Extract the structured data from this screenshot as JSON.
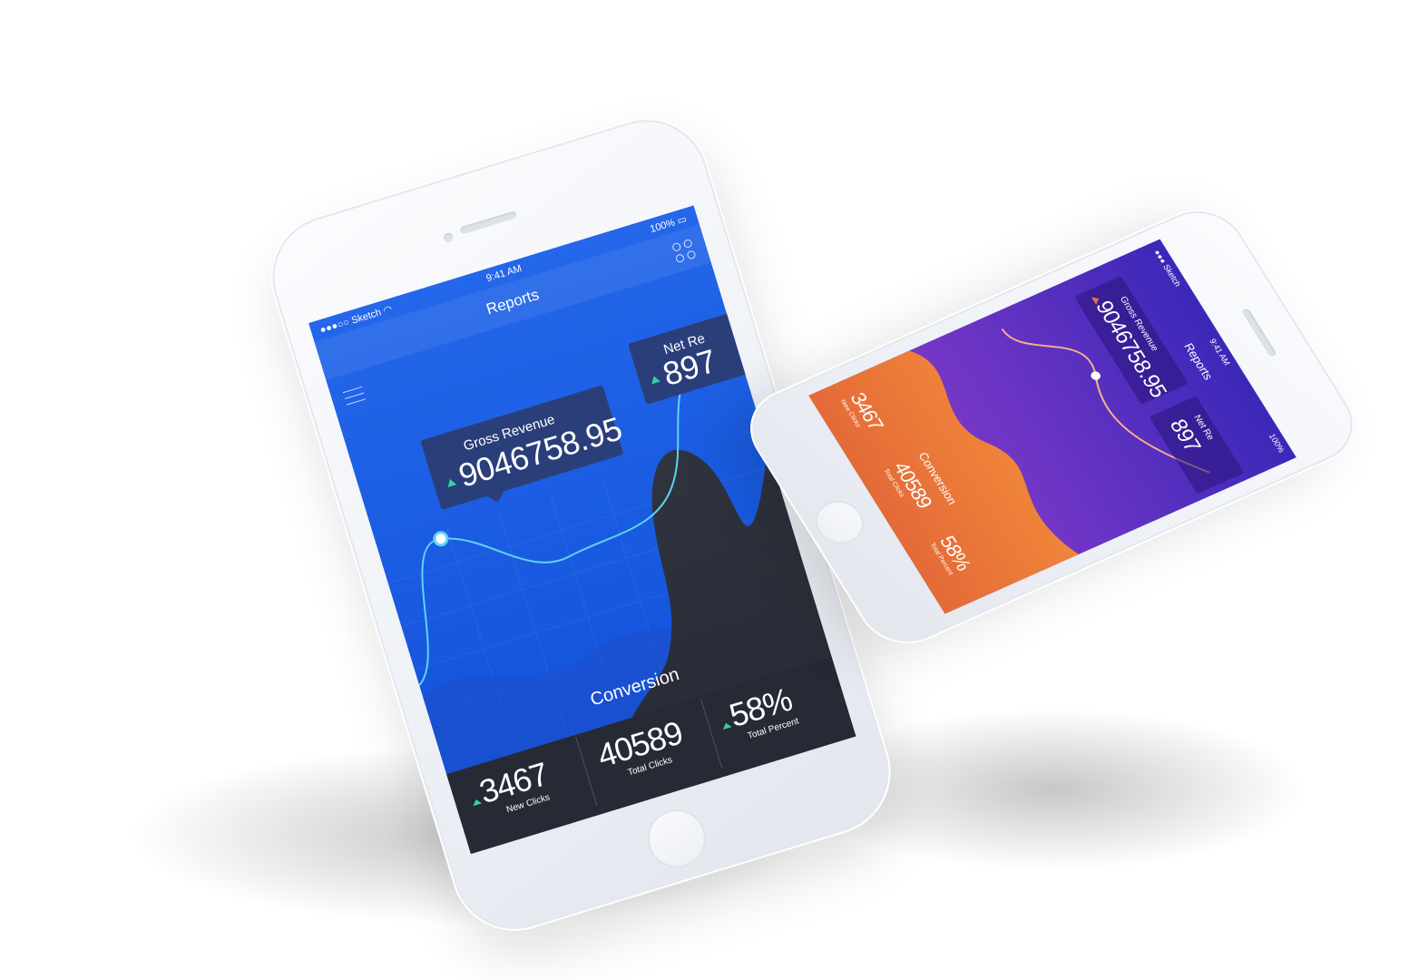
{
  "status_bar": {
    "carrier": "Sketch",
    "time": "9:41 AM",
    "battery": "100%"
  },
  "nav": {
    "title": "Reports"
  },
  "cards": {
    "gross": {
      "label": "Gross Revenue",
      "value": "9046758.95"
    },
    "net_front": {
      "label": "Net Re",
      "value": "897"
    },
    "net_back": {
      "label": "Net Re",
      "value": "897"
    }
  },
  "conversion": {
    "title": "Conversion",
    "stats": [
      {
        "value": "3467",
        "label": "New Clicks"
      },
      {
        "value": "40589",
        "label": "Total Clicks"
      },
      {
        "value": "58%",
        "label": "Total Percent"
      }
    ]
  },
  "themes": {
    "front": {
      "sky": "#1a5ae6",
      "navbar": "#2f6ae8",
      "dark": "#2b2f3c",
      "card": "#2a3f7a",
      "accent": "#35d0a0",
      "line": "#5fd3f0"
    },
    "back": {
      "top": "#3b28b8",
      "mid": "#6a34c4",
      "bottom": "#e8743a",
      "accent": "#e8743a"
    }
  }
}
